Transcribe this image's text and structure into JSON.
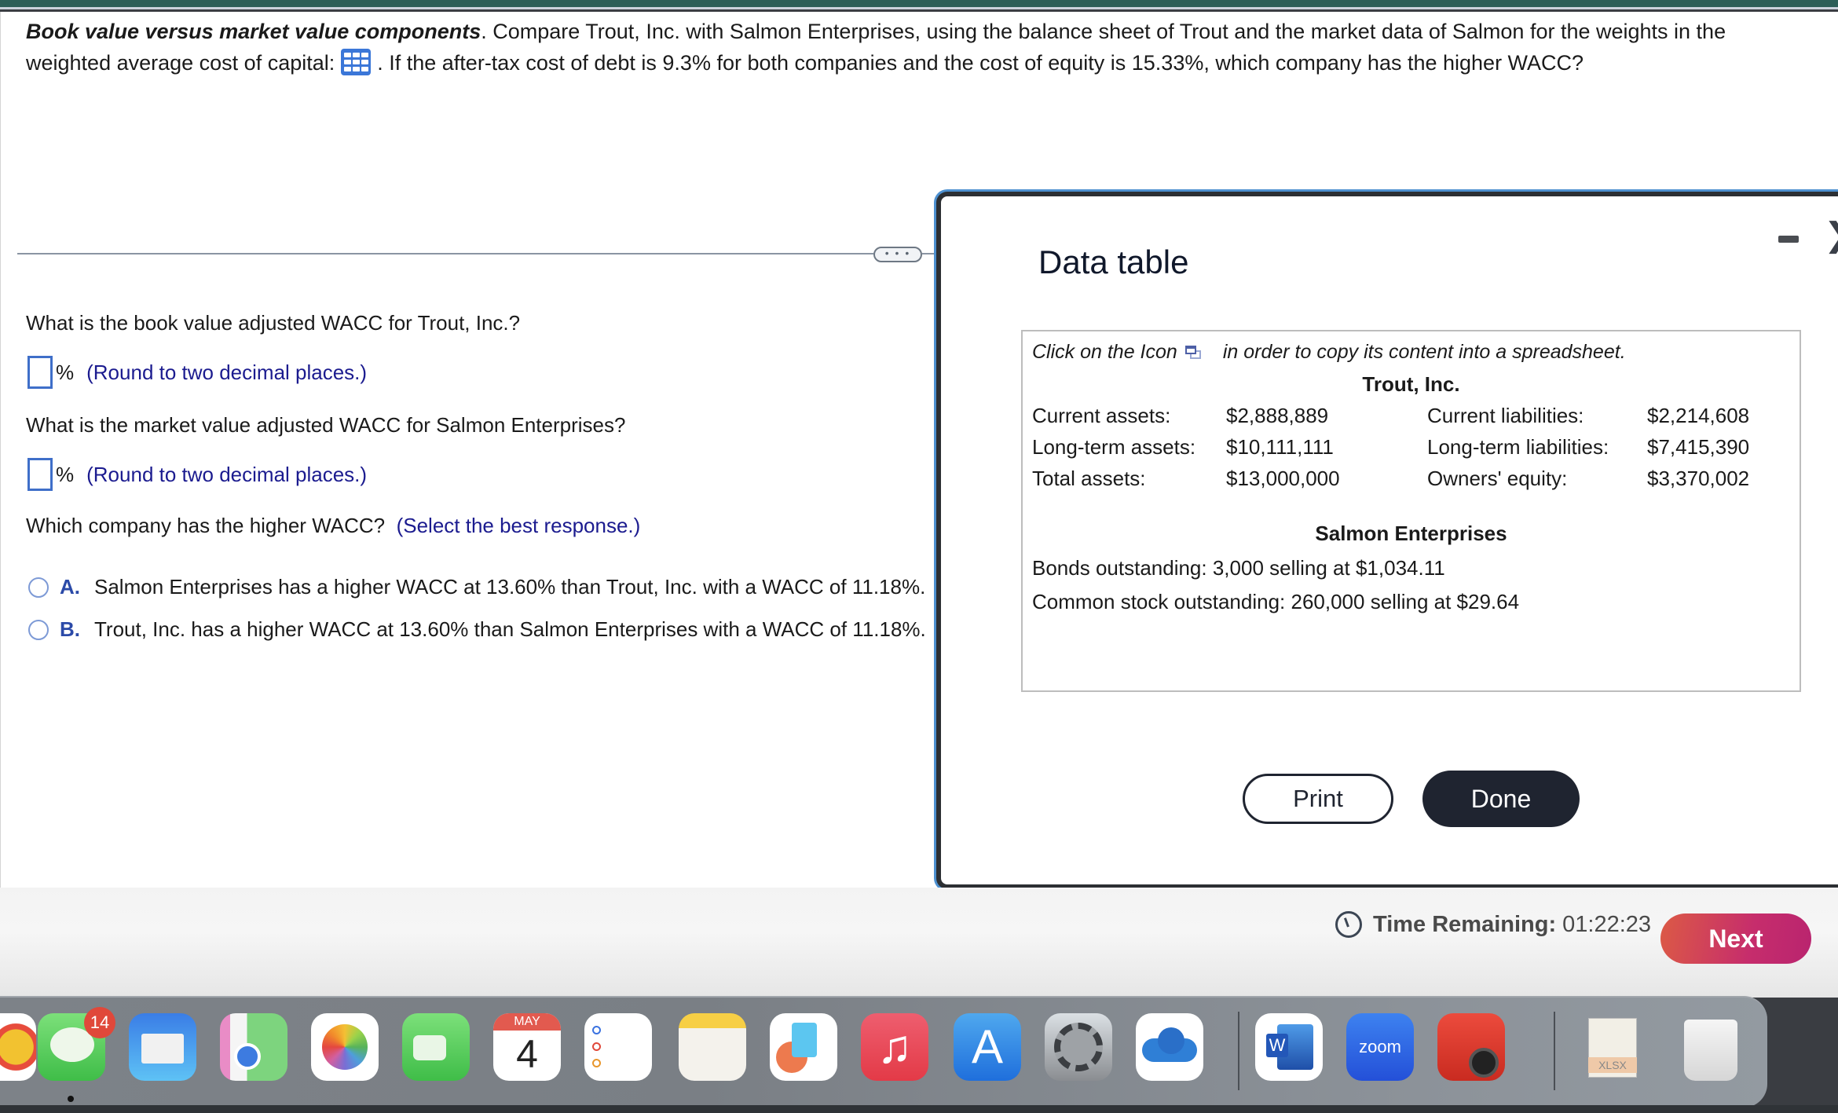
{
  "question": {
    "title": "Book value versus market value components",
    "text_part1": ".  Compare Trout, Inc. with Salmon Enterprises, using the balance sheet of Trout and the market data of Salmon for the weights in the weighted average cost of capital:",
    "text_part2": ".  If the after-tax cost of debt is 9.3% for both companies and the cost of equity is 15.33%, which company has the higher WACC?",
    "data_icon": "table-grid-icon"
  },
  "divider": {
    "handle_label": "• • •"
  },
  "parts": {
    "q1": "What is the book value adjusted WACC for Trout, Inc.?",
    "q1_input_value": "",
    "q1_unit": "%",
    "q1_hint": "(Round to two decimal places.)",
    "q2": "What is the market value adjusted WACC for Salmon Enterprises?",
    "q2_input_value": "",
    "q2_unit": "%",
    "q2_hint": "(Round to two decimal places.)",
    "q3": "Which company has the higher WACC?",
    "q3_hint": "(Select the best response.)",
    "options": [
      {
        "letter": "A.",
        "text": "Salmon Enterprises has a higher WACC at 13.60% than Trout, Inc. with a WACC of 11.18%.",
        "selected": false
      },
      {
        "letter": "B.",
        "text": "Trout, Inc. has a higher WACC at 13.60% than Salmon Enterprises with a WACC of 11.18%.",
        "selected": false
      }
    ]
  },
  "modal": {
    "title": "Data table",
    "minimize_icon": "minimize-icon",
    "close_icon": "close-icon",
    "copy_note_before": "Click on the Icon",
    "copy_note_after": "in order to copy its content into a spreadsheet.",
    "trout": {
      "title": "Trout, Inc.",
      "rows": [
        {
          "label1": "Current assets:",
          "value1": "$2,888,889",
          "label2": "Current liabilities:",
          "value2": "$2,214,608"
        },
        {
          "label1": "Long-term assets:",
          "value1": "$10,111,111",
          "label2": "Long-term liabilities:",
          "value2": "$7,415,390"
        },
        {
          "label1": "Total assets:",
          "value1": "$13,000,000",
          "label2": "Owners' equity:",
          "value2": "$3,370,002"
        }
      ]
    },
    "salmon": {
      "title": "Salmon Enterprises",
      "bonds": "Bonds outstanding:  3,000 selling at $1,034.11",
      "stock": "Common stock outstanding:  260,000 selling at $29.64"
    },
    "print_label": "Print",
    "done_label": "Done"
  },
  "footer": {
    "timer_label": "Time Remaining:",
    "timer_value": "01:22:23",
    "next_label": "Next"
  },
  "dock": {
    "messages_badge": "14",
    "calendar_month": "MAY",
    "calendar_day": "4",
    "apps": [
      "chrome",
      "messages",
      "mail",
      "maps",
      "photos",
      "facetime",
      "calendar",
      "reminders",
      "notes",
      "freeform",
      "music",
      "app-store",
      "system-settings",
      "onedrive",
      "word",
      "zoom",
      "photo-booth",
      "xlsx-document",
      "trash"
    ],
    "zoom_label": "zoom",
    "word_label": "W",
    "xlsx_label": "XLSX"
  },
  "colors": {
    "topbar": "#2b5e57",
    "hint_blue": "#1b1b8f",
    "input_border": "#3f6fc9",
    "done_bg": "#1f2430",
    "next_gradient_start": "#dc5a45",
    "next_gradient_end": "#b9246f"
  }
}
